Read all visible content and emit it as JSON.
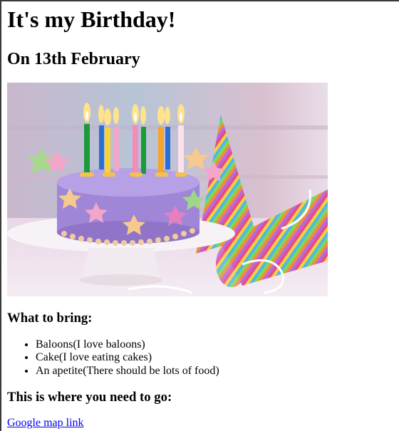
{
  "page": {
    "title": "It's my Birthday!",
    "subtitle": "On 13th February",
    "bring_heading": "What to bring:",
    "bring_items": [
      "Baloons(I love baloons)",
      "Cake(I love eating cakes)",
      "An apetite(There should be lots of food)"
    ],
    "location_heading": "This is where you need to go:",
    "map_link": "Google map link"
  },
  "colors": {
    "link": "#0000ee",
    "cake_purple": "#9f86d6",
    "plate_white": "#f6f2f5"
  }
}
